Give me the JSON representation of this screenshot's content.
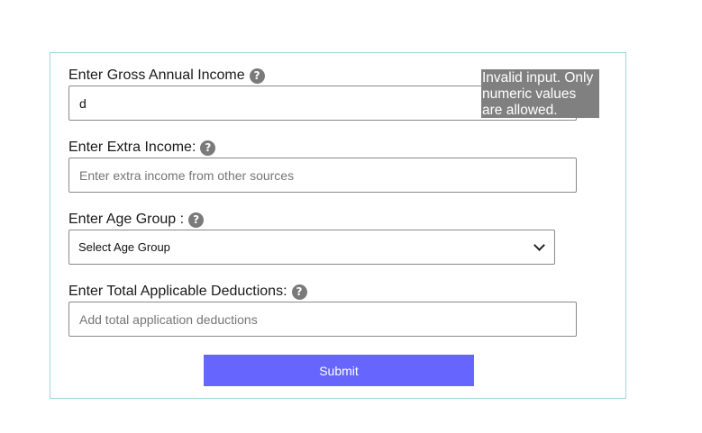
{
  "form": {
    "gross_income": {
      "label": "Enter Gross Annual Income",
      "value": "d",
      "help_icon": "question-circle-icon",
      "error_tooltip": "Invalid input. Only numeric values are allowed."
    },
    "extra_income": {
      "label": "Enter Extra Income:",
      "placeholder": "Enter extra income from other sources",
      "help_icon": "question-circle-icon"
    },
    "age_group": {
      "label": "Enter Age Group :",
      "selected": "Select Age Group",
      "help_icon": "question-circle-icon"
    },
    "deductions": {
      "label": "Enter Total Applicable Deductions:",
      "placeholder": "Add total application deductions",
      "help_icon": "question-circle-icon"
    },
    "submit_label": "Submit"
  },
  "colors": {
    "card_border": "#9fd3e0",
    "submit_bg": "#6666ff",
    "tooltip_bg": "#808080",
    "help_icon": "#7a7a7a"
  }
}
